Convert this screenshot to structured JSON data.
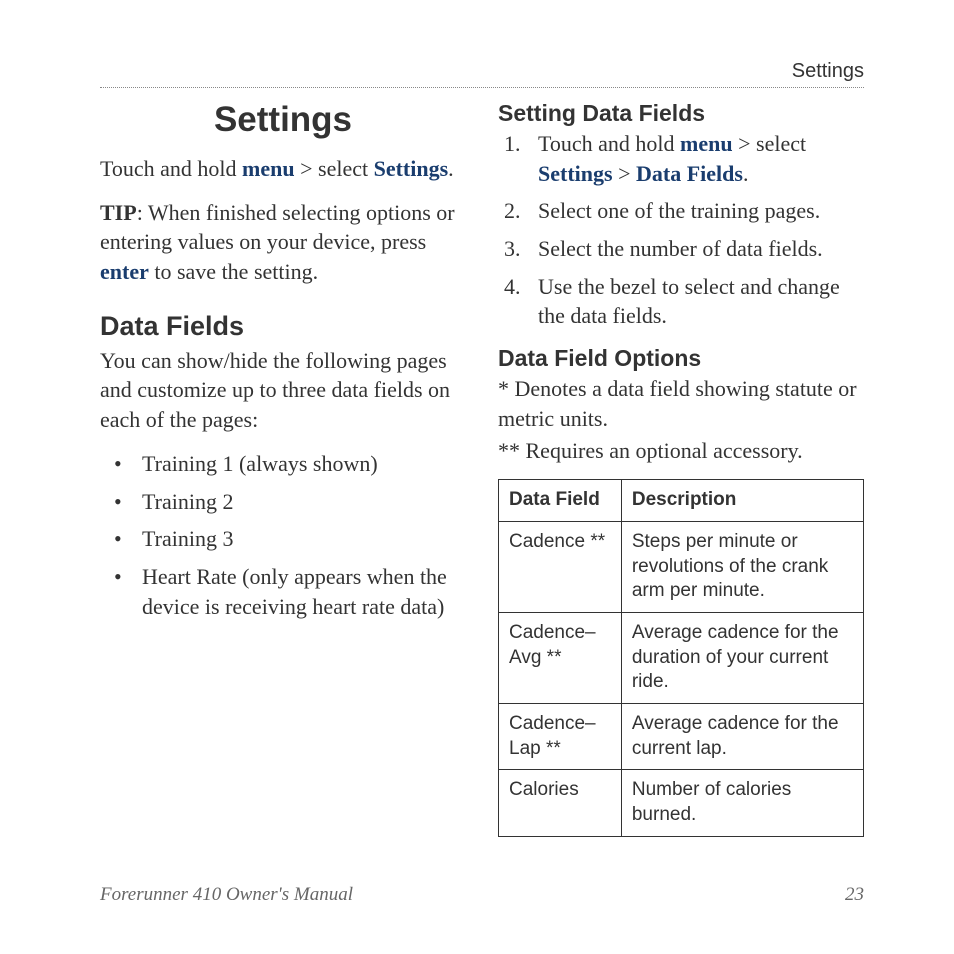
{
  "header": {
    "section": "Settings"
  },
  "left": {
    "title": "Settings",
    "intro": {
      "pre": "Touch and hold ",
      "menu": "menu",
      "mid": " > select ",
      "settings": "Settings",
      "end": "."
    },
    "tip": {
      "label": "TIP",
      "body_pre": ": When finished selecting options or entering values on your device, press ",
      "enter": "enter",
      "body_post": " to save the setting."
    },
    "datafields_heading": "Data Fields",
    "datafields_intro": "You can show/hide the following pages and customize up to three data fields on each of the pages:",
    "pages": [
      "Training 1 (always shown)",
      "Training 2",
      "Training 3",
      "Heart Rate (only appears when the device is receiving heart rate data)"
    ]
  },
  "right": {
    "setting_heading": "Setting Data Fields",
    "steps": {
      "s1": {
        "pre": "Touch and hold ",
        "menu": "menu",
        "mid": " > select ",
        "settings": "Settings",
        "gt": " > ",
        "df": "Data Fields",
        "end": "."
      },
      "s2": "Select one of the training pages.",
      "s3": "Select the number of data fields.",
      "s4": "Use the bezel to select and change the data fields."
    },
    "options_heading": "Data Field Options",
    "note1": "* Denotes a data field showing statute or metric units.",
    "note2": "** Requires an optional accessory.",
    "table": {
      "h1": "Data Field",
      "h2": "Description",
      "rows": [
        {
          "f": "Cadence **",
          "d": "Steps per minute or revolutions of the crank arm per minute."
        },
        {
          "f": "Cadence–Avg **",
          "d": "Average cadence for the duration of your current ride."
        },
        {
          "f": "Cadence–Lap **",
          "d": "Average cadence for the current lap."
        },
        {
          "f": "Calories",
          "d": "Number of calories burned."
        }
      ]
    }
  },
  "footer": {
    "title": "Forerunner 410 Owner's Manual",
    "page": "23"
  }
}
